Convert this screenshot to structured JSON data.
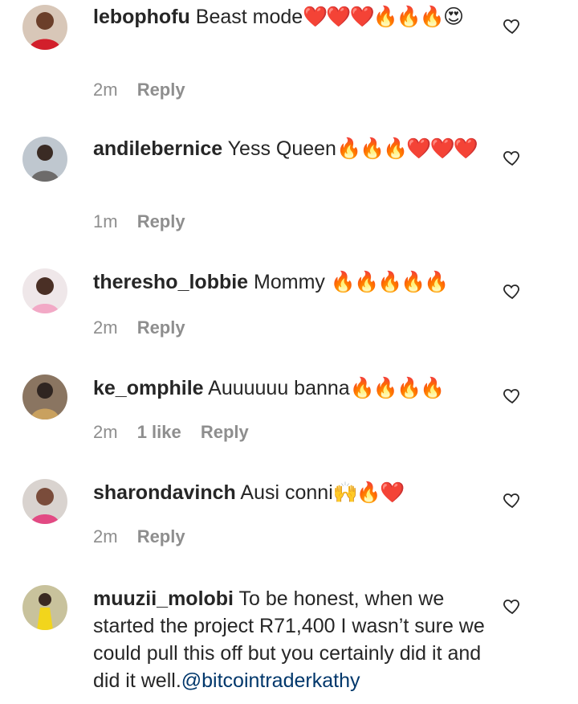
{
  "comments": [
    {
      "username": "lebophofu",
      "text": "Beast mode",
      "emoji": "❤️❤️❤️🔥🔥🔥😍",
      "time": "2m",
      "likes": "",
      "reply_label": "Reply"
    },
    {
      "username": "andilebernice",
      "text": "Yess Queen",
      "emoji": "🔥🔥🔥❤️❤️❤️",
      "time": "1m",
      "likes": "",
      "reply_label": "Reply"
    },
    {
      "username": "theresho_lobbie",
      "text": "Mommy",
      "emoji": "🔥🔥🔥🔥🔥",
      "time": "2m",
      "likes": "",
      "reply_label": "Reply"
    },
    {
      "username": "ke_omphile",
      "text": "Auuuuuu banna",
      "emoji": "🔥🔥🔥🔥",
      "time": "2m",
      "likes": "1 like",
      "reply_label": "Reply"
    },
    {
      "username": "sharondavinch",
      "text": "Ausi conni",
      "emoji": "🙌🔥❤️",
      "time": "2m",
      "likes": "",
      "reply_label": "Reply"
    },
    {
      "username": "muuzii_molobi",
      "text": "To be honest, when we started the project R71,400 I wasn’t sure we could pull this off but you certainly did it and did it well.",
      "mention": "@bitcointraderkathy",
      "emoji": "",
      "time": "",
      "likes": "",
      "reply_label": ""
    }
  ],
  "colors": {
    "text": "#262626",
    "meta": "#8e8e8e",
    "mention": "#00376b"
  },
  "icons": {
    "like": "heart-outline-icon",
    "avatar": "user-avatar"
  }
}
